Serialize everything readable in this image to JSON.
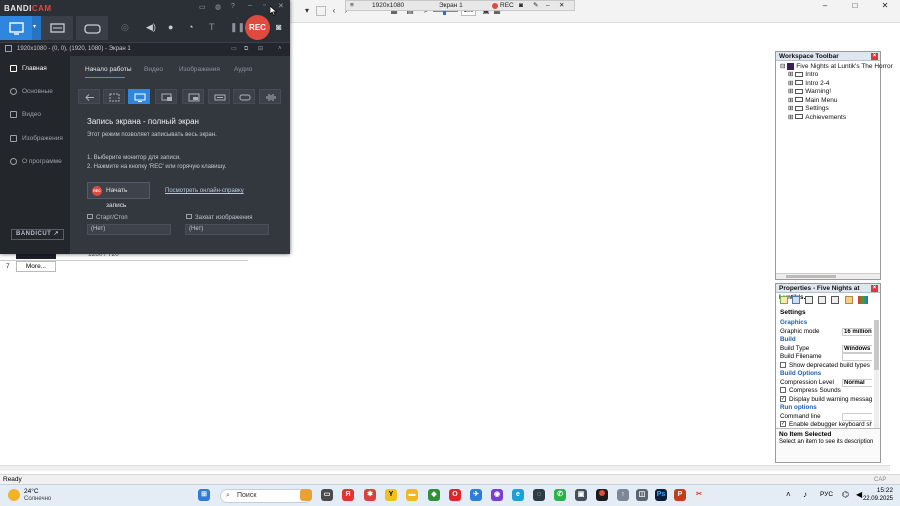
{
  "app_toolbar": {
    "resolution_label": "1920x1080",
    "screen_label": "Экран 1",
    "rec_label": "REC",
    "zoom_value": "100"
  },
  "workspace_toolbar": {
    "title": "Workspace Toolbar",
    "root": "Five Nights at Luntik's The Horror",
    "items": [
      "Intro",
      "Intro 2-4",
      "Warning!",
      "Main Menu",
      "Settings",
      "Achievements"
    ]
  },
  "properties": {
    "title": "Properties - Five Nights at Luntik's...",
    "settings_header": "Settings",
    "rows": [
      {
        "type": "section",
        "label": "Graphics"
      },
      {
        "type": "field",
        "label": "Graphic mode",
        "value": "16 million c"
      },
      {
        "type": "section",
        "label": "Build"
      },
      {
        "type": "field",
        "label": "Build Type",
        "value": "Windows E"
      },
      {
        "type": "field",
        "label": "Build Filename",
        "value": ""
      },
      {
        "type": "check",
        "label": "Show deprecated build types",
        "checked": false
      },
      {
        "type": "section",
        "label": "Build Options"
      },
      {
        "type": "field",
        "label": "Compression Level",
        "value": "Normal"
      },
      {
        "type": "check",
        "label": "Compress Sounds",
        "checked": false
      },
      {
        "type": "check",
        "label": "Display build warning messages",
        "checked": true
      },
      {
        "type": "section",
        "label": "Run options"
      },
      {
        "type": "field",
        "label": "Command line",
        "value": ""
      },
      {
        "type": "check",
        "label": "Enable debugger keyboard shor",
        "checked": true
      }
    ],
    "no_item_title": "No Item Selected",
    "no_item_desc": "Select an item to see its description"
  },
  "left_list": {
    "row_number": "7",
    "more_label": "More...",
    "partial_text": "1280 / 720"
  },
  "statusbar": {
    "left": "Ready",
    "right": "CAP NUM"
  },
  "taskbar": {
    "weather_temp": "24°C",
    "weather_desc": "Солнечно",
    "search_placeholder": "Поиск",
    "lang": "РУС",
    "time": "15:22",
    "date": "22.09.2025"
  },
  "bandicam": {
    "logo_bandi": "BANDI",
    "logo_cam": "CAM",
    "rec_label": "REC",
    "info_text": "1920x1080 - (0, 0), (1920, 1080) - Экран 1",
    "side_items": [
      "Главная",
      "Основные",
      "Видео",
      "Изображения",
      "О программе"
    ],
    "bandicut_label": "BANDICUT ↗",
    "tabs": [
      "Начало работы",
      "Видео",
      "Изображения",
      "Аудио"
    ],
    "mode_title": "Запись экрана - полный экран",
    "mode_desc": "Этот режим позволяет записывать весь экран.",
    "step1": "1. Выберите монитор для записи.",
    "step2": "2. Нажмите на кнопку 'REC' или горячую клавишу.",
    "start_label": "Начать запись",
    "start_dot": "REC",
    "help_link": "Посмотреть онлайн-справку",
    "hotkey_rec_label": "Старт/Стоп",
    "hotkey_img_label": "Захват изображения",
    "hotkey_rec_value": "(Нет)",
    "hotkey_img_value": "(Нет)",
    "accent_color": "#2e86de",
    "rec_color": "#e14a3e"
  }
}
